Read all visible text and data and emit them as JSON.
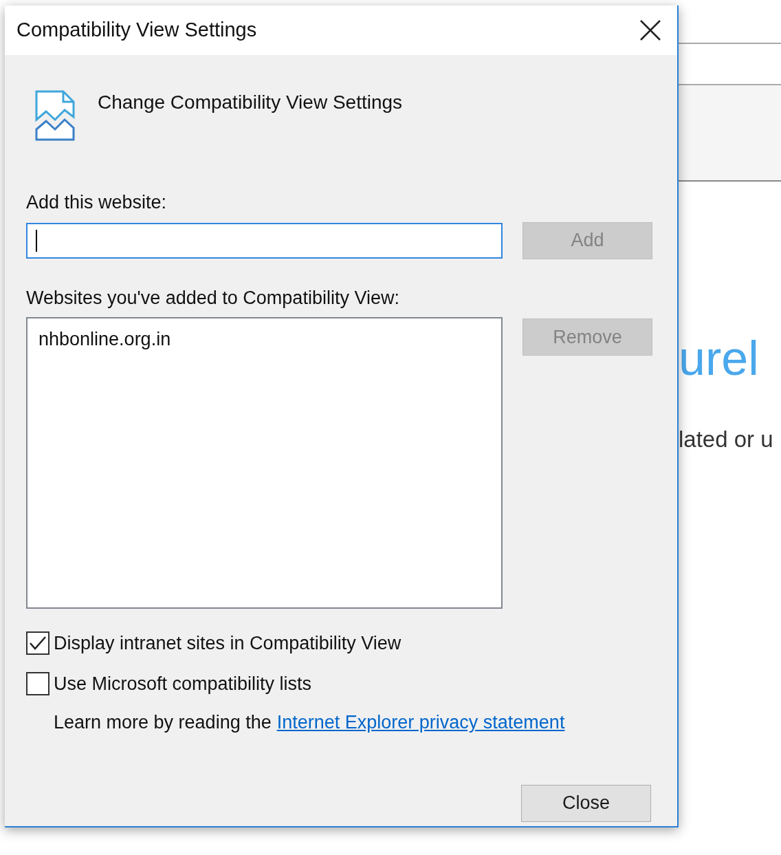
{
  "window": {
    "title": "Compatibility View Settings"
  },
  "header": "Change Compatibility View Settings",
  "add_field": {
    "label": "Add this website:",
    "focused": true
  },
  "add_button": {
    "label": "Add",
    "disabled": true
  },
  "list": {
    "label": "Websites you've added to Compatibility View:",
    "items": [
      {
        "text": "nhbonline.org.in",
        "selected": false
      }
    ]
  },
  "remove_button": {
    "label": "Remove",
    "disabled": true
  },
  "checkboxes": [
    {
      "label": "Display intranet sites in Compatibility View",
      "checked": true
    },
    {
      "label": "Use Microsoft compatibility lists",
      "checked": false
    }
  ],
  "learn_more": {
    "text": "Learn more by reading the",
    "link": "Internet Explorer privacy statement"
  },
  "close_button": {
    "label": "Close"
  },
  "background_page": {
    "heading_fragment": "urel",
    "text_fragment": "lated or u"
  }
}
